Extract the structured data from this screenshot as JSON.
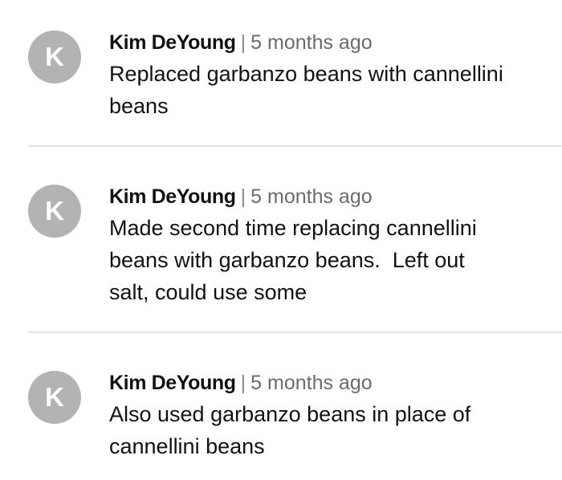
{
  "comments": [
    {
      "avatar_letter": "K",
      "author": "Kim DeYoung",
      "separator": "|",
      "time": "5 months ago",
      "text": "Replaced garbanzo beans with cannellini\nbeans"
    },
    {
      "avatar_letter": "K",
      "author": "Kim DeYoung",
      "separator": "|",
      "time": "5 months ago",
      "text": "Made second time replacing cannellini\nbeans with garbanzo beans.  Left out\nsalt, could use some"
    },
    {
      "avatar_letter": "K",
      "author": "Kim DeYoung",
      "separator": "|",
      "time": "5 months ago",
      "text": "Also used garbanzo beans in place of\ncannellini beans"
    }
  ],
  "colors": {
    "avatar_bg": "#b3b3b3",
    "text": "#121212",
    "timestamp": "#6b6b6b",
    "divider": "#e2e2e2"
  }
}
